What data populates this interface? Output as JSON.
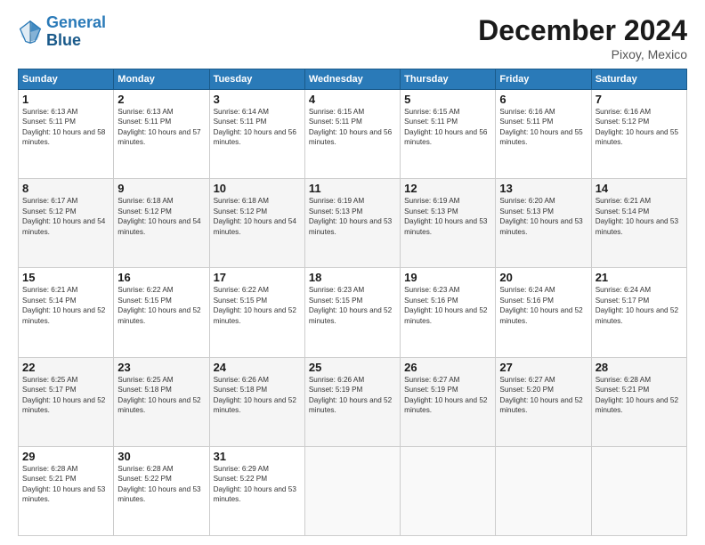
{
  "logo": {
    "line1": "General",
    "line2": "Blue"
  },
  "title": "December 2024",
  "location": "Pixoy, Mexico",
  "days_of_week": [
    "Sunday",
    "Monday",
    "Tuesday",
    "Wednesday",
    "Thursday",
    "Friday",
    "Saturday"
  ],
  "weeks": [
    [
      {
        "day": 1,
        "sunrise": "6:13 AM",
        "sunset": "5:11 PM",
        "daylight": "10 hours and 58 minutes."
      },
      {
        "day": 2,
        "sunrise": "6:13 AM",
        "sunset": "5:11 PM",
        "daylight": "10 hours and 57 minutes."
      },
      {
        "day": 3,
        "sunrise": "6:14 AM",
        "sunset": "5:11 PM",
        "daylight": "10 hours and 56 minutes."
      },
      {
        "day": 4,
        "sunrise": "6:15 AM",
        "sunset": "5:11 PM",
        "daylight": "10 hours and 56 minutes."
      },
      {
        "day": 5,
        "sunrise": "6:15 AM",
        "sunset": "5:11 PM",
        "daylight": "10 hours and 56 minutes."
      },
      {
        "day": 6,
        "sunrise": "6:16 AM",
        "sunset": "5:11 PM",
        "daylight": "10 hours and 55 minutes."
      },
      {
        "day": 7,
        "sunrise": "6:16 AM",
        "sunset": "5:12 PM",
        "daylight": "10 hours and 55 minutes."
      }
    ],
    [
      {
        "day": 8,
        "sunrise": "6:17 AM",
        "sunset": "5:12 PM",
        "daylight": "10 hours and 54 minutes."
      },
      {
        "day": 9,
        "sunrise": "6:18 AM",
        "sunset": "5:12 PM",
        "daylight": "10 hours and 54 minutes."
      },
      {
        "day": 10,
        "sunrise": "6:18 AM",
        "sunset": "5:12 PM",
        "daylight": "10 hours and 54 minutes."
      },
      {
        "day": 11,
        "sunrise": "6:19 AM",
        "sunset": "5:13 PM",
        "daylight": "10 hours and 53 minutes."
      },
      {
        "day": 12,
        "sunrise": "6:19 AM",
        "sunset": "5:13 PM",
        "daylight": "10 hours and 53 minutes."
      },
      {
        "day": 13,
        "sunrise": "6:20 AM",
        "sunset": "5:13 PM",
        "daylight": "10 hours and 53 minutes."
      },
      {
        "day": 14,
        "sunrise": "6:21 AM",
        "sunset": "5:14 PM",
        "daylight": "10 hours and 53 minutes."
      }
    ],
    [
      {
        "day": 15,
        "sunrise": "6:21 AM",
        "sunset": "5:14 PM",
        "daylight": "10 hours and 52 minutes."
      },
      {
        "day": 16,
        "sunrise": "6:22 AM",
        "sunset": "5:15 PM",
        "daylight": "10 hours and 52 minutes."
      },
      {
        "day": 17,
        "sunrise": "6:22 AM",
        "sunset": "5:15 PM",
        "daylight": "10 hours and 52 minutes."
      },
      {
        "day": 18,
        "sunrise": "6:23 AM",
        "sunset": "5:15 PM",
        "daylight": "10 hours and 52 minutes."
      },
      {
        "day": 19,
        "sunrise": "6:23 AM",
        "sunset": "5:16 PM",
        "daylight": "10 hours and 52 minutes."
      },
      {
        "day": 20,
        "sunrise": "6:24 AM",
        "sunset": "5:16 PM",
        "daylight": "10 hours and 52 minutes."
      },
      {
        "day": 21,
        "sunrise": "6:24 AM",
        "sunset": "5:17 PM",
        "daylight": "10 hours and 52 minutes."
      }
    ],
    [
      {
        "day": 22,
        "sunrise": "6:25 AM",
        "sunset": "5:17 PM",
        "daylight": "10 hours and 52 minutes."
      },
      {
        "day": 23,
        "sunrise": "6:25 AM",
        "sunset": "5:18 PM",
        "daylight": "10 hours and 52 minutes."
      },
      {
        "day": 24,
        "sunrise": "6:26 AM",
        "sunset": "5:18 PM",
        "daylight": "10 hours and 52 minutes."
      },
      {
        "day": 25,
        "sunrise": "6:26 AM",
        "sunset": "5:19 PM",
        "daylight": "10 hours and 52 minutes."
      },
      {
        "day": 26,
        "sunrise": "6:27 AM",
        "sunset": "5:19 PM",
        "daylight": "10 hours and 52 minutes."
      },
      {
        "day": 27,
        "sunrise": "6:27 AM",
        "sunset": "5:20 PM",
        "daylight": "10 hours and 52 minutes."
      },
      {
        "day": 28,
        "sunrise": "6:28 AM",
        "sunset": "5:21 PM",
        "daylight": "10 hours and 52 minutes."
      }
    ],
    [
      {
        "day": 29,
        "sunrise": "6:28 AM",
        "sunset": "5:21 PM",
        "daylight": "10 hours and 53 minutes."
      },
      {
        "day": 30,
        "sunrise": "6:28 AM",
        "sunset": "5:22 PM",
        "daylight": "10 hours and 53 minutes."
      },
      {
        "day": 31,
        "sunrise": "6:29 AM",
        "sunset": "5:22 PM",
        "daylight": "10 hours and 53 minutes."
      },
      null,
      null,
      null,
      null
    ]
  ]
}
